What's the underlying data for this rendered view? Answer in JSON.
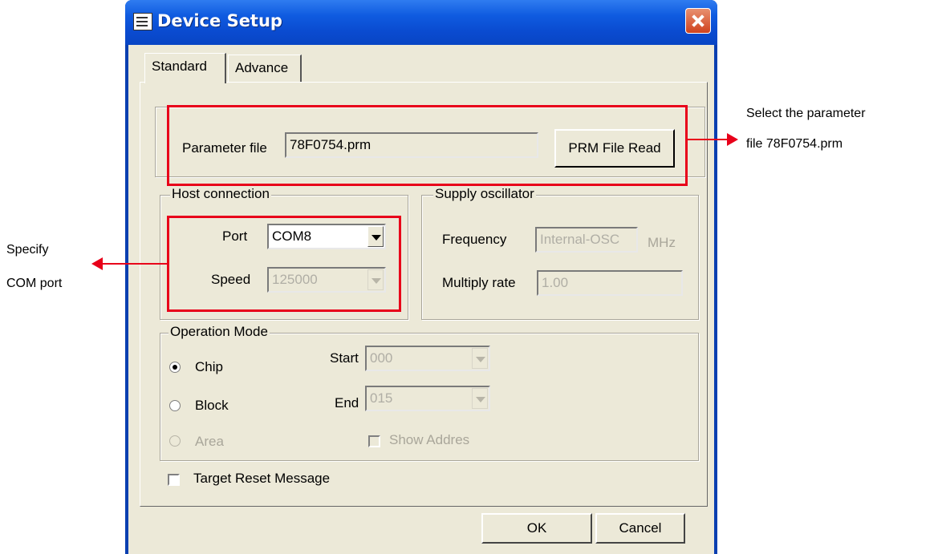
{
  "window": {
    "title": "Device Setup"
  },
  "tabs": [
    {
      "label": "Standard"
    },
    {
      "label": "Advance"
    }
  ],
  "parameter": {
    "label": "Parameter file",
    "value": "78F0754.prm",
    "button": "PRM File Read"
  },
  "host_connection": {
    "title": "Host connection",
    "port_label": "Port",
    "port_value": "COM8",
    "speed_label": "Speed",
    "speed_value": "125000"
  },
  "supply_oscillator": {
    "title": "Supply oscillator",
    "frequency_label": "Frequency",
    "frequency_value": "Internal-OSC",
    "frequency_unit": "MHz",
    "multiply_label": "Multiply rate",
    "multiply_value": "1.00"
  },
  "operation_mode": {
    "title": "Operation Mode",
    "chip": "Chip",
    "block": "Block",
    "area": "Area",
    "start_label": "Start",
    "start_value": "000",
    "end_label": "End",
    "end_value": "015",
    "show_address": "Show Addres"
  },
  "target_reset": "Target Reset Message",
  "buttons": {
    "ok": "OK",
    "cancel": "Cancel"
  },
  "annotations": {
    "right_line1": "Select  the  parameter",
    "right_line2": "file 78F0754.prm",
    "left_line1": "Specify",
    "left_line2": "COM port"
  },
  "colors": {
    "highlight": "#e8001a",
    "titlebar": "#0a4bd0",
    "dialog_bg": "#ece9d8"
  }
}
